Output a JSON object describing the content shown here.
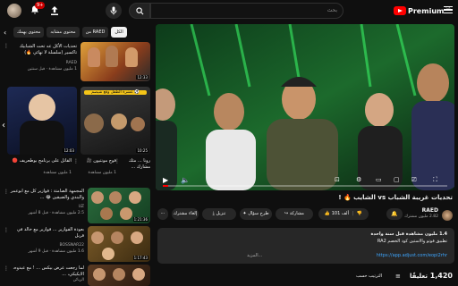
{
  "topbar": {
    "search_placeholder": "بحث",
    "notif_count": "9+",
    "logo_text": "Premium",
    "logo_region": "SA"
  },
  "chips": [
    "الكل",
    "من RAED",
    "محتوى مشابه",
    "محتوى يهمك"
  ],
  "cards": [
    {
      "title": "تحديات الأكل عه تحت الشبابيك تاكسير (سلسلة لا نهائي 🔥)",
      "meta": "RAED",
      "meta2": "1 مليون مشاهدة · قبل سنتين",
      "duration": "12:33"
    },
    {
      "title": "عشرة الطفل وقع شيصم ⚽",
      "meta": "",
      "meta2": "",
      "duration": "10:25"
    },
    {
      "title": "القاتل على برنامج بوطعريف 🔴",
      "meta": "",
      "meta2": "1 مليون مشاهدة",
      "duration": "12:03"
    },
    {
      "title": "فوج مونتيون 🎥",
      "meta": "",
      "meta2": "1 مليون مشاهدة",
      "duration": "2:33"
    },
    {
      "title": "رونا ... مثك مشارك ...",
      "meta": "",
      "meta2": "",
      "duration": "4:08"
    },
    {
      "title": "المجمهة الصامتة : فوازير كل مع ابوعمر والبندي والضيقين 😂 ...",
      "meta": "UZ",
      "meta2": "2.5 مليون مشاهدة · قبل 8 أشهر",
      "duration": "1:21:36"
    },
    {
      "title": "بعودة الفوازير ... فوازير مع خالد في قربل",
      "meta": "BOSSNAR22",
      "meta2": "1.6 مليون مشاهدة · قبل 9 أشهر",
      "duration": "1:17:43"
    },
    {
      "title": "لما رجعت عرض بيكس ... ! مع عبدوه، الايكيكي، ...",
      "meta": "الزبائن",
      "meta2": "1 مليون مشاهدة",
      "duration": "29:57"
    }
  ],
  "player": {
    "time": "",
    "progress": 0.02
  },
  "video": {
    "title": "تحديات غريبة الشباب vs الشايب 🔥 !",
    "channel": "RAED",
    "subs": "2.82 مليون مشترك",
    "subscribe_label": "إلغاء مشترك",
    "likes": "101 ألف",
    "share": "مشاركة",
    "ask": "طرح سؤال",
    "download": "تنزيل"
  },
  "description": {
    "line1": "1.4 مليون مشاهدة قبل سنة واحدة",
    "line2": "تطبيق فوتو والاستين كود الخصم RA2",
    "line3": "https://app.adjust.com/eopi2rhr",
    "more": "...المزيد"
  },
  "comments": {
    "count": "1,420",
    "label": "تعليقًا",
    "sort": "الترتيب حسب"
  }
}
